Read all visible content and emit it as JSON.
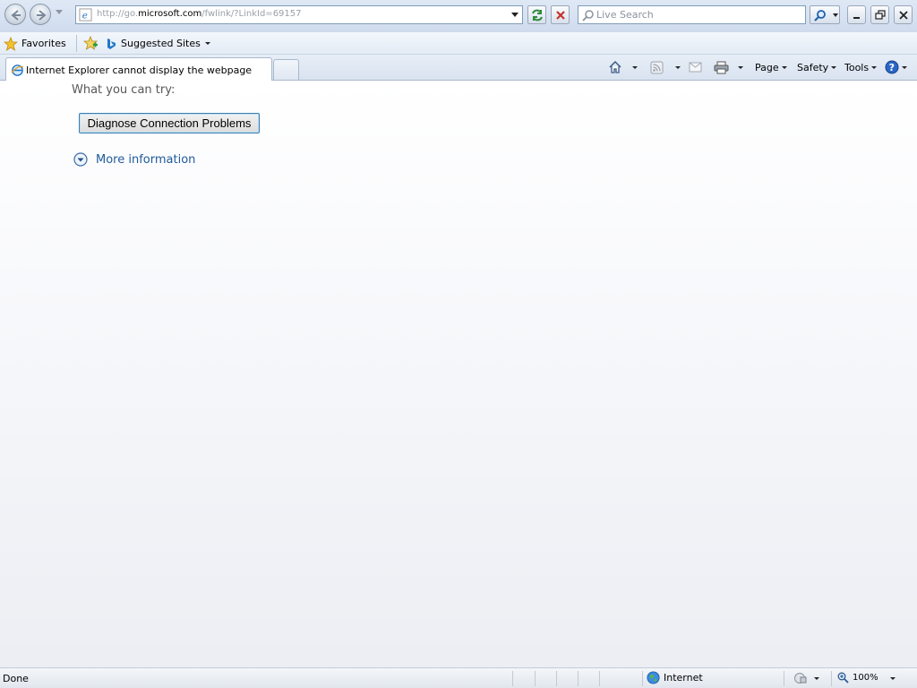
{
  "browser": {
    "address": {
      "url_prefix": "http://go.",
      "url_domain": "microsoft.com",
      "url_suffix": "/fwlink/?LinkId=69157"
    },
    "search": {
      "placeholder": "Live Search"
    }
  },
  "favorites_bar": {
    "favorites_label": "Favorites",
    "suggested_sites_label": "Suggested Sites"
  },
  "tabs": [
    {
      "title": "Internet Explorer cannot display the webpage",
      "icon": "ie-page-icon"
    }
  ],
  "command_bar": {
    "page_label": "Page",
    "safety_label": "Safety",
    "tools_label": "Tools"
  },
  "content": {
    "heading": "What you can try:",
    "diagnose_button": "Diagnose Connection Problems",
    "more_info_label": "More information"
  },
  "status_bar": {
    "status": "Done",
    "zone": "Internet",
    "zoom": "100%"
  },
  "colors": {
    "link": "#1f5a9a",
    "chrome": "#dfe8f5",
    "content_bg": "#f7f8fb"
  }
}
